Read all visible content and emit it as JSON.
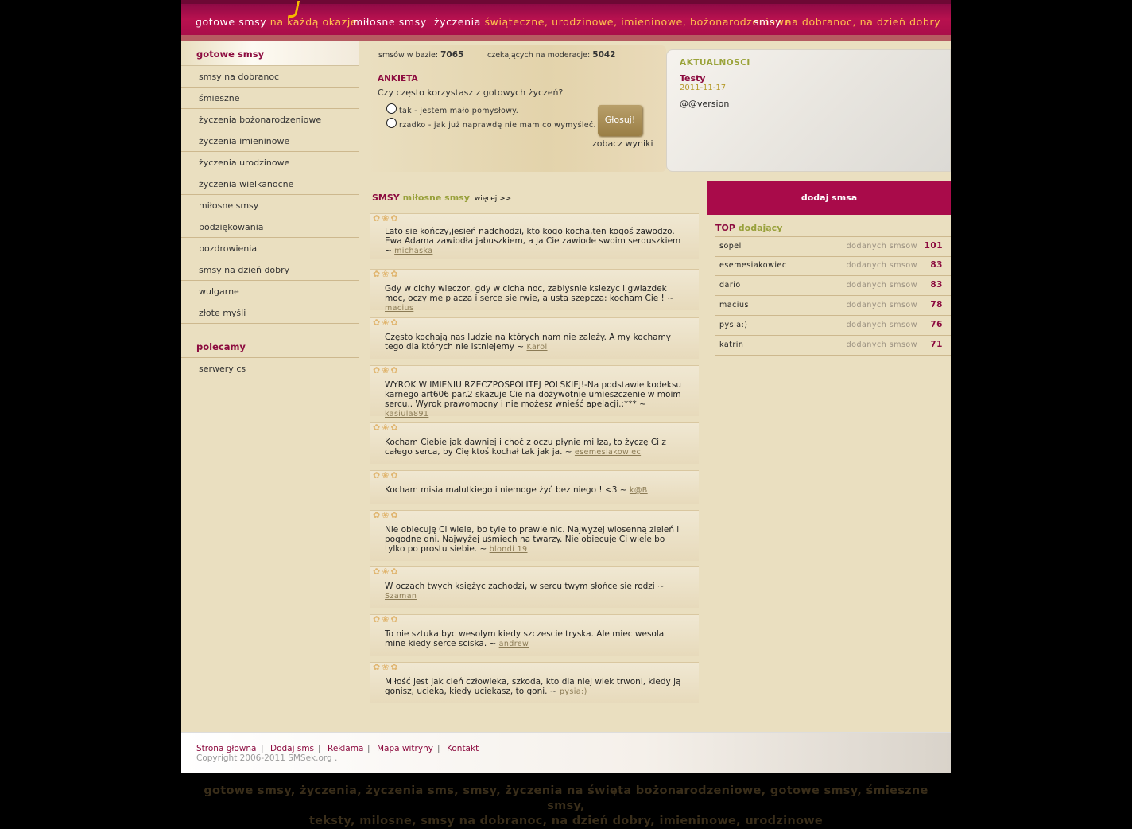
{
  "topnav": {
    "items": [
      {
        "white": "gotowe smsy",
        "yellow": "na każdą okazje"
      },
      {
        "white": "miłosne smsy",
        "yellow": ""
      },
      {
        "white": "życzenia",
        "yellow": "świąteczne, urodzinowe, imieninowe, bożonarodzeniowe"
      },
      {
        "white": "smsy",
        "yellow": "na dobranoc, na dzień dobry"
      }
    ]
  },
  "sidebar": {
    "title": "gotowe smsy",
    "items": [
      "smsy na dobranoc",
      "śmieszne",
      "życzenia bożonarodzeniowe",
      "życzenia imieninowe",
      "życzenia urodzinowe",
      "życzenia wielkanocne",
      "miłosne smsy",
      "podziękowania",
      "pozdrowienia",
      "smsy na dzień dobry",
      "wulgarne",
      "złote myśli"
    ],
    "recommended_title": "polecamy",
    "recommended": [
      "serwery cs"
    ]
  },
  "stats": {
    "in_base_label": "smsów w bazie:",
    "in_base": "7065",
    "pending_label": "czekających na moderacje:",
    "pending": "5042"
  },
  "poll": {
    "title": "ANKIETA",
    "question": "Czy często korzystasz z gotowych życzeń?",
    "options": [
      "tak - jestem mało pomysłowy.",
      "rzadko - jak już naprawdę nie mam co wymyśleć."
    ],
    "vote_label": "Głosuj!",
    "results_label": "zobacz wyniki"
  },
  "news": {
    "title": "AKTUALNOSCI",
    "item_title": "Testy",
    "item_date": "2011-11-17",
    "item_body": "@@version"
  },
  "section": {
    "prefix": "SMSY",
    "name": "miłosne smsy",
    "more": "więcej >>"
  },
  "messages": [
    {
      "text": "Lato sie kończy,jesień nadchodzi, kto kogo kocha,ten kogoś zawodzo. Ewa Adama zawiodła jabuszkiem, a ja Cie zawiode swoim serduszkiem ~",
      "author": "michaska"
    },
    {
      "text": "Gdy w cichy wieczor, gdy w cicha noc, zablysnie ksiezyc i gwiazdek moc, oczy me placza i serce sie rwie, a usta szepcza: kocham Cie ! ~",
      "author": "macius"
    },
    {
      "text": "Często kochają nas ludzie na których nam nie zależy. A my kochamy tego dla których nie istniejemy ~",
      "author": "Karol"
    },
    {
      "text": "WYROK W IMIENIU RZECZPOSPOLITEJ POLSKIEJ!-Na podstawie kodeksu karnego art606 par.2 skazuje Cie na dożywotnie umieszczenie w moim sercu.. Wyrok prawomocny i nie możesz wnieść apelacji.:*** ~",
      "author": "kasiula891"
    },
    {
      "text": "Kocham Ciebie jak dawniej i choć z oczu płynie mi łza, to życzę Ci z całego serca, by Cię ktoś kochał tak jak ja. ~",
      "author": "esemesiakowiec"
    },
    {
      "text": "Kocham misia malutkiego i niemoge żyć bez niego ! <3 ~",
      "author": "k@B"
    },
    {
      "text": "Nie obiecuję Ci wiele, bo tyle to prawie nic. Najwyżej wiosenną zieleń i pogodne dni. Najwyżej uśmiech na twarzy. Nie obiecuje Ci wiele bo tylko po prostu siebie. ~",
      "author": "blondi 19"
    },
    {
      "text": "W oczach twych księżyc zachodzi, w sercu twym słońce się rodzi ~",
      "author": "Szaman"
    },
    {
      "text": "To nie sztuka byc wesolym kiedy szczescie tryska. Ale miec wesola mine kiedy serce sciska. ~",
      "author": "andrew"
    },
    {
      "text": "Miłość jest jak cień człowieka, szkoda, kto dla niej wiek trwoni, kiedy ją gonisz, ucieka, kiedy uciekasz, to goni. ~",
      "author": "pysia:)"
    }
  ],
  "add_sms_label": "dodaj smsa",
  "top": {
    "prefix": "TOP",
    "name": "dodający",
    "rows": [
      {
        "name": "sopel",
        "label": "dodanych smsow",
        "count": "101"
      },
      {
        "name": "esemesiakowiec",
        "label": "dodanych smsow",
        "count": "83"
      },
      {
        "name": "dario",
        "label": "dodanych smsow",
        "count": "83"
      },
      {
        "name": "macius",
        "label": "dodanych smsow",
        "count": "78"
      },
      {
        "name": "pysia:)",
        "label": "dodanych smsow",
        "count": "76"
      },
      {
        "name": "katrin",
        "label": "dodanych smsow",
        "count": "71"
      }
    ]
  },
  "footer": {
    "links": [
      "Strona głowna",
      "Dodaj sms",
      "Reklama",
      "Mapa witryny",
      "Kontakt"
    ],
    "copyright": "Copyright 2006-2011 SMSek.org ."
  },
  "tagline": {
    "line1": "gotowe smsy, życzenia, życzenia sms, smsy, życzenia na święta bożonarodzeniowe, gotowe smsy, śmieszne smsy,",
    "line2": "teksty, milosne, smsy na dobranoc, na dzień dobry, imieninowe, urodzinowe"
  }
}
